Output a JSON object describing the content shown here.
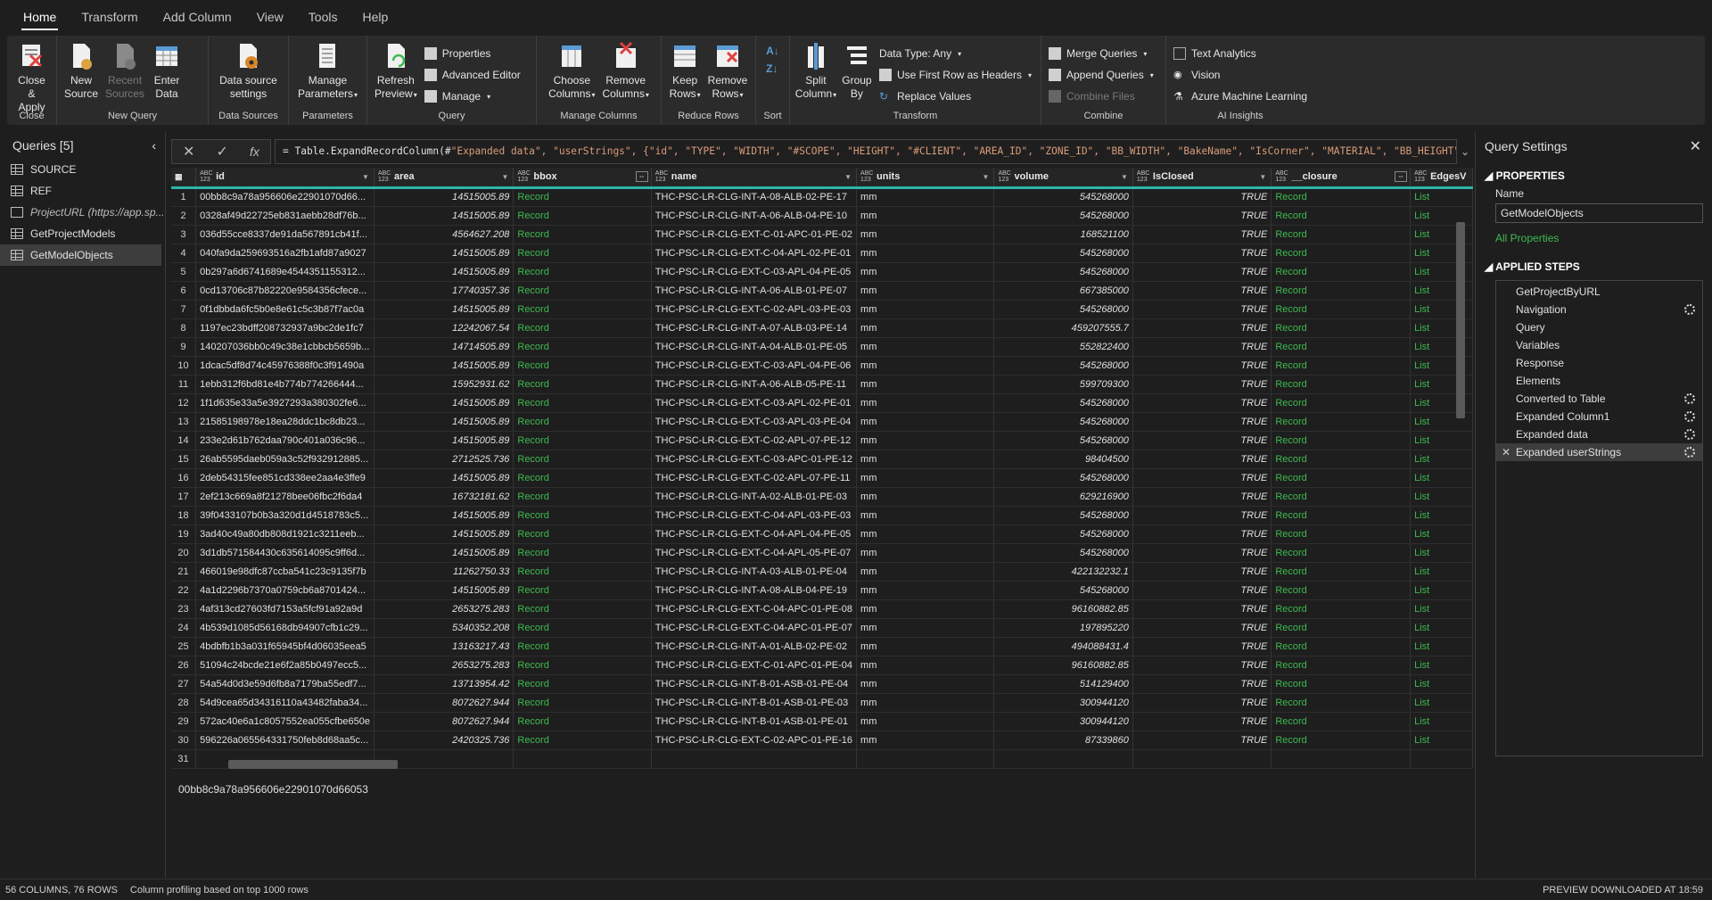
{
  "menu": {
    "tabs": [
      "Home",
      "Transform",
      "Add Column",
      "View",
      "Tools",
      "Help"
    ]
  },
  "ribbon": {
    "close": {
      "close_apply": "Close &\nApply",
      "label": "Close"
    },
    "new_query": {
      "new_source": "New\nSource",
      "recent_sources": "Recent\nSources",
      "enter_data": "Enter\nData",
      "label": "New Query"
    },
    "data_sources": {
      "settings": "Data source\nsettings",
      "label": "Data Sources"
    },
    "parameters": {
      "manage": "Manage\nParameters",
      "label": "Parameters"
    },
    "query": {
      "refresh": "Refresh\nPreview",
      "properties": "Properties",
      "advanced_editor": "Advanced Editor",
      "manage": "Manage",
      "label": "Query"
    },
    "manage_columns": {
      "choose": "Choose\nColumns",
      "remove": "Remove\nColumns",
      "label": "Manage Columns"
    },
    "reduce_rows": {
      "keep": "Keep\nRows",
      "remove": "Remove\nRows",
      "label": "Reduce Rows"
    },
    "sort": {
      "label": "Sort"
    },
    "transform": {
      "split": "Split\nColumn",
      "group_by": "Group\nBy",
      "data_type": "Data Type: Any",
      "first_row": "Use First Row as Headers",
      "replace": "Replace Values",
      "label": "Transform"
    },
    "combine": {
      "merge": "Merge Queries",
      "append": "Append Queries",
      "combine_files": "Combine Files",
      "label": "Combine"
    },
    "ai": {
      "text_analytics": "Text Analytics",
      "vision": "Vision",
      "azure_ml": "Azure Machine Learning",
      "label": "AI Insights"
    }
  },
  "queries_pane": {
    "title": "Queries [5]",
    "items": [
      {
        "label": "SOURCE",
        "italic": false
      },
      {
        "label": "REF",
        "italic": false
      },
      {
        "label": "ProjectURL (https://app.sp...",
        "italic": true
      },
      {
        "label": "GetProjectModels",
        "italic": false
      },
      {
        "label": "GetModelObjects",
        "italic": false,
        "selected": true
      }
    ]
  },
  "formula": {
    "text_prefix": "= Table.ExpandRecordColumn(#",
    "text_rest": "\"Expanded data\", \"userStrings\", {\"id\", \"TYPE\", \"WIDTH\", \"#SCOPE\", \"HEIGHT\", \"#CLIENT\", \"AREA_ID\", \"ZONE_ID\", \"BB_WIDTH\", \"BakeName\", \"IsCorner\", \"MATERIAL\", \"BB_HEIGHT\","
  },
  "grid": {
    "columns": [
      {
        "key": "id",
        "type": "ABC\n123",
        "name": "id"
      },
      {
        "key": "area",
        "type": "ABC\n123",
        "name": "area"
      },
      {
        "key": "bbox",
        "type": "ABC\n123",
        "name": "bbox"
      },
      {
        "key": "name",
        "type": "ABC\n123",
        "name": "name"
      },
      {
        "key": "units",
        "type": "ABC\n123",
        "name": "units"
      },
      {
        "key": "volume",
        "type": "ABC\n123",
        "name": "volume"
      },
      {
        "key": "isClosed",
        "type": "ABC\n123",
        "name": "IsClosed"
      },
      {
        "key": "closure",
        "type": "ABC\n123",
        "name": "__closure"
      },
      {
        "key": "edges",
        "type": "ABC\n123",
        "name": "EdgesV"
      }
    ],
    "rows": [
      [
        "00bb8c9a78a956606e22901070d66...",
        "14515005.89",
        "Record",
        "THC-PSC-LR-CLG-INT-A-08-ALB-02-PE-17",
        "mm",
        "545268000",
        "TRUE",
        "Record",
        "List"
      ],
      [
        "0328af49d22725eb831aebb28df76b...",
        "14515005.89",
        "Record",
        "THC-PSC-LR-CLG-INT-A-06-ALB-04-PE-10",
        "mm",
        "545268000",
        "TRUE",
        "Record",
        "List"
      ],
      [
        "036d55cce8337de91da567891cb41f...",
        "4564627.208",
        "Record",
        "THC-PSC-LR-CLG-EXT-C-01-APC-01-PE-02",
        "mm",
        "168521100",
        "TRUE",
        "Record",
        "List"
      ],
      [
        "040fa9da259693516a2fb1afd87a9027",
        "14515005.89",
        "Record",
        "THC-PSC-LR-CLG-EXT-C-04-APL-02-PE-01",
        "mm",
        "545268000",
        "TRUE",
        "Record",
        "List"
      ],
      [
        "0b297a6d6741689e4544351155312...",
        "14515005.89",
        "Record",
        "THC-PSC-LR-CLG-EXT-C-03-APL-04-PE-05",
        "mm",
        "545268000",
        "TRUE",
        "Record",
        "List"
      ],
      [
        "0cd13706c87b82220e9584356cfece...",
        "17740357.36",
        "Record",
        "THC-PSC-LR-CLG-INT-A-06-ALB-01-PE-07",
        "mm",
        "667385000",
        "TRUE",
        "Record",
        "List"
      ],
      [
        "0f1dbbda6fc5b0e8e61c5c3b87f7ac0a",
        "14515005.89",
        "Record",
        "THC-PSC-LR-CLG-EXT-C-02-APL-03-PE-03",
        "mm",
        "545268000",
        "TRUE",
        "Record",
        "List"
      ],
      [
        "1197ec23bdff208732937a9bc2de1fc7",
        "12242067.54",
        "Record",
        "THC-PSC-LR-CLG-INT-A-07-ALB-03-PE-14",
        "mm",
        "459207555.7",
        "TRUE",
        "Record",
        "List"
      ],
      [
        "140207036bb0c49c38e1cbbcb5659b...",
        "14714505.89",
        "Record",
        "THC-PSC-LR-CLG-INT-A-04-ALB-01-PE-05",
        "mm",
        "552822400",
        "TRUE",
        "Record",
        "List"
      ],
      [
        "1dcac5df8d74c45976388f0c3f91490a",
        "14515005.89",
        "Record",
        "THC-PSC-LR-CLG-EXT-C-03-APL-04-PE-06",
        "mm",
        "545268000",
        "TRUE",
        "Record",
        "List"
      ],
      [
        "1ebb312f6bd81e4b774b774266444...",
        "15952931.62",
        "Record",
        "THC-PSC-LR-CLG-INT-A-06-ALB-05-PE-11",
        "mm",
        "599709300",
        "TRUE",
        "Record",
        "List"
      ],
      [
        "1f1d635e33a5e3927293a380302fe6...",
        "14515005.89",
        "Record",
        "THC-PSC-LR-CLG-EXT-C-03-APL-02-PE-01",
        "mm",
        "545268000",
        "TRUE",
        "Record",
        "List"
      ],
      [
        "21585198978e18ea28ddc1bc8db23...",
        "14515005.89",
        "Record",
        "THC-PSC-LR-CLG-EXT-C-03-APL-03-PE-04",
        "mm",
        "545268000",
        "TRUE",
        "Record",
        "List"
      ],
      [
        "233e2d61b762daa790c401a036c96...",
        "14515005.89",
        "Record",
        "THC-PSC-LR-CLG-EXT-C-02-APL-07-PE-12",
        "mm",
        "545268000",
        "TRUE",
        "Record",
        "List"
      ],
      [
        "26ab5595daeb059a3c52f932912885...",
        "2712525.736",
        "Record",
        "THC-PSC-LR-CLG-EXT-C-03-APC-01-PE-12",
        "mm",
        "98404500",
        "TRUE",
        "Record",
        "List"
      ],
      [
        "2deb54315fee851cd338ee2aa4e3ffe9",
        "14515005.89",
        "Record",
        "THC-PSC-LR-CLG-EXT-C-02-APL-07-PE-11",
        "mm",
        "545268000",
        "TRUE",
        "Record",
        "List"
      ],
      [
        "2ef213c669a8f21278bee06fbc2f6da4",
        "16732181.62",
        "Record",
        "THC-PSC-LR-CLG-INT-A-02-ALB-01-PE-03",
        "mm",
        "629216900",
        "TRUE",
        "Record",
        "List"
      ],
      [
        "39f0433107b0b3a320d1d4518783c5...",
        "14515005.89",
        "Record",
        "THC-PSC-LR-CLG-EXT-C-04-APL-03-PE-03",
        "mm",
        "545268000",
        "TRUE",
        "Record",
        "List"
      ],
      [
        "3ad40c49a80db808d1921c3211eeb...",
        "14515005.89",
        "Record",
        "THC-PSC-LR-CLG-EXT-C-04-APL-04-PE-05",
        "mm",
        "545268000",
        "TRUE",
        "Record",
        "List"
      ],
      [
        "3d1db571584430c635614095c9ff6d...",
        "14515005.89",
        "Record",
        "THC-PSC-LR-CLG-EXT-C-04-APL-05-PE-07",
        "mm",
        "545268000",
        "TRUE",
        "Record",
        "List"
      ],
      [
        "466019e98dfc87ccba541c23c9135f7b",
        "11262750.33",
        "Record",
        "THC-PSC-LR-CLG-INT-A-03-ALB-01-PE-04",
        "mm",
        "422132232.1",
        "TRUE",
        "Record",
        "List"
      ],
      [
        "4a1d2296b7370a0759cb6a8701424...",
        "14515005.89",
        "Record",
        "THC-PSC-LR-CLG-INT-A-08-ALB-04-PE-19",
        "mm",
        "545268000",
        "TRUE",
        "Record",
        "List"
      ],
      [
        "4af313cd27603fd7153a5fcf91a92a9d",
        "2653275.283",
        "Record",
        "THC-PSC-LR-CLG-EXT-C-04-APC-01-PE-08",
        "mm",
        "96160882.85",
        "TRUE",
        "Record",
        "List"
      ],
      [
        "4b539d1085d56168db94907cfb1c29...",
        "5340352.208",
        "Record",
        "THC-PSC-LR-CLG-EXT-C-04-APC-01-PE-07",
        "mm",
        "197895220",
        "TRUE",
        "Record",
        "List"
      ],
      [
        "4bdbfb1b3a031f65945bf4d06035eea5",
        "13163217.43",
        "Record",
        "THC-PSC-LR-CLG-INT-A-01-ALB-02-PE-02",
        "mm",
        "494088431.4",
        "TRUE",
        "Record",
        "List"
      ],
      [
        "51094c24bcde21e6f2a85b0497ecc5...",
        "2653275.283",
        "Record",
        "THC-PSC-LR-CLG-EXT-C-01-APC-01-PE-04",
        "mm",
        "96160882.85",
        "TRUE",
        "Record",
        "List"
      ],
      [
        "54a54d0d3e59d6fb8a7179ba55edf7...",
        "13713954.42",
        "Record",
        "THC-PSC-LR-CLG-INT-B-01-ASB-01-PE-04",
        "mm",
        "514129400",
        "TRUE",
        "Record",
        "List"
      ],
      [
        "54d9cea65d34316110a43482faba34...",
        "8072627.944",
        "Record",
        "THC-PSC-LR-CLG-INT-B-01-ASB-01-PE-03",
        "mm",
        "300944120",
        "TRUE",
        "Record",
        "List"
      ],
      [
        "572ac40e6a1c8057552ea055cfbe650e",
        "8072627.944",
        "Record",
        "THC-PSC-LR-CLG-INT-B-01-ASB-01-PE-01",
        "mm",
        "300944120",
        "TRUE",
        "Record",
        "List"
      ],
      [
        "596226a065564331750feb8d68aa5c...",
        "2420325.736",
        "Record",
        "THC-PSC-LR-CLG-EXT-C-02-APC-01-PE-16",
        "mm",
        "87339860",
        "TRUE",
        "Record",
        "List"
      ],
      [
        "",
        "",
        "",
        "",
        "",
        "",
        "",
        "",
        ""
      ]
    ]
  },
  "preview_value": "00bb8c9a78a956606e22901070d66053",
  "settings": {
    "title": "Query Settings",
    "properties_label": "PROPERTIES",
    "name_label": "Name",
    "name_value": "GetModelObjects",
    "all_properties": "All Properties",
    "applied_steps_label": "APPLIED STEPS",
    "steps": [
      {
        "label": "GetProjectByURL",
        "gear": false
      },
      {
        "label": "Navigation",
        "gear": true
      },
      {
        "label": "Query",
        "gear": false
      },
      {
        "label": "Variables",
        "gear": false
      },
      {
        "label": "Response",
        "gear": false
      },
      {
        "label": "Elements",
        "gear": false
      },
      {
        "label": "Converted to Table",
        "gear": true
      },
      {
        "label": "Expanded Column1",
        "gear": true
      },
      {
        "label": "Expanded data",
        "gear": true
      },
      {
        "label": "Expanded userStrings",
        "gear": true,
        "selected": true
      }
    ]
  },
  "status": {
    "columns_rows": "56 COLUMNS, 76 ROWS",
    "profiling": "Column profiling based on top 1000 rows",
    "downloaded": "PREVIEW DOWNLOADED AT 18:59"
  }
}
